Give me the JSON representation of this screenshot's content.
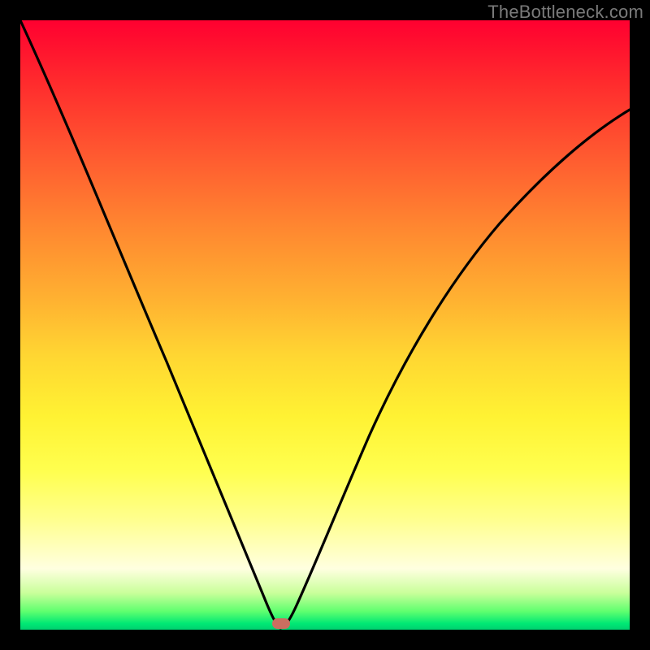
{
  "watermark": "TheBottleneck.com",
  "chart_data": {
    "type": "line",
    "title": "",
    "xlabel": "",
    "ylabel": "",
    "xlim": [
      0,
      100
    ],
    "ylim": [
      0,
      100
    ],
    "series": [
      {
        "name": "bottleneck-curve",
        "x": [
          0,
          5,
          10,
          15,
          20,
          25,
          28,
          31,
          34,
          37,
          39,
          41,
          42.5,
          43,
          44,
          46,
          48,
          51,
          55,
          60,
          66,
          72,
          78,
          85,
          92,
          100
        ],
        "y": [
          100,
          87,
          74,
          61,
          49,
          36,
          28,
          20,
          12,
          6,
          2.5,
          0.8,
          0.2,
          0.3,
          1.0,
          3.5,
          8,
          15,
          24,
          34,
          44,
          52,
          59,
          66,
          71,
          76
        ]
      }
    ],
    "annotations": [
      {
        "name": "recommended-marker",
        "x": 43,
        "y": 0.5,
        "color": "#cc6e60"
      }
    ],
    "background": "vertical-gradient-red-yellow-green"
  }
}
